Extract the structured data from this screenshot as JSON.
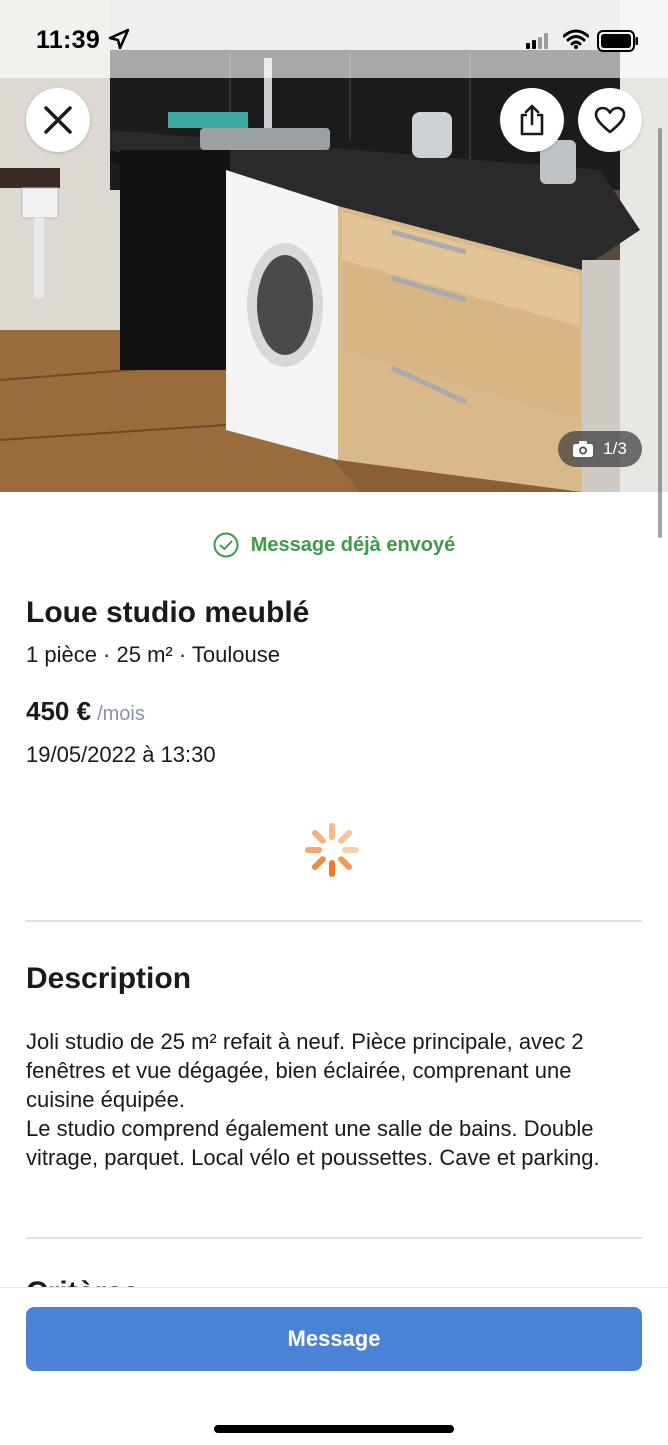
{
  "status_bar": {
    "time": "11:39"
  },
  "photo": {
    "counter": "1/3",
    "current": 1,
    "total": 3
  },
  "header_icons": {
    "close": "close-icon",
    "share": "share-icon",
    "favorite": "heart-icon"
  },
  "notice": {
    "text": "Message déjà envoyé",
    "icon": "check-circle-icon",
    "color": "#3f9a4a"
  },
  "listing": {
    "title": "Loue studio meublé",
    "details": "1 pièce · 25 m² · Toulouse",
    "price": "450 €",
    "price_unit": "/mois",
    "date": "19/05/2022 à 13:30"
  },
  "description": {
    "heading": "Description",
    "paragraph_1": "Joli studio de 25 m² refait à neuf. Pièce principale, avec 2 fenêtres et vue dégagée, bien éclairée, comprenant une cuisine équipée.",
    "paragraph_2": "Le studio comprend également une salle de bains. Double vitrage, parquet. Local vélo et poussettes. Cave et parking."
  },
  "next_section": {
    "heading_partial": "Critères"
  },
  "cta": {
    "label": "Message",
    "color": "#4a83d6"
  },
  "colors": {
    "accent_orange": "#f07a2a",
    "divider": "#dcdfe3"
  }
}
